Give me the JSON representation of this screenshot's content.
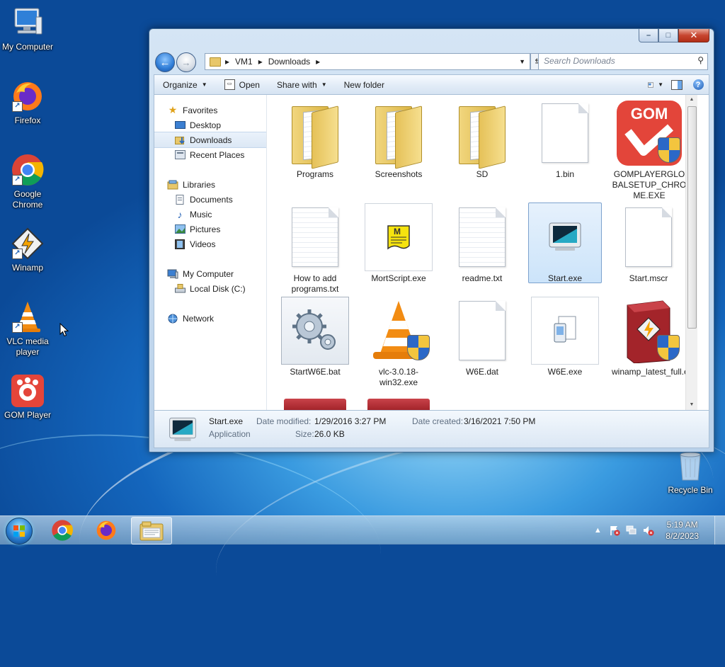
{
  "desktop": {
    "icons": [
      {
        "label": "My Computer"
      },
      {
        "label": "Firefox"
      },
      {
        "label": "Google Chrome"
      },
      {
        "label": "Winamp"
      },
      {
        "label": "VLC media player"
      },
      {
        "label": "GOM Player"
      },
      {
        "label": "Recycle Bin"
      }
    ]
  },
  "window": {
    "breadcrumb": [
      "VM1",
      "Downloads"
    ],
    "search_placeholder": "Search Downloads",
    "toolbar": {
      "organize": "Organize",
      "open": "Open",
      "share_with": "Share with",
      "new_folder": "New folder"
    },
    "nav": {
      "favorites": "Favorites",
      "desktop": "Desktop",
      "downloads": "Downloads",
      "recent_places": "Recent Places",
      "libraries": "Libraries",
      "documents": "Documents",
      "music": "Music",
      "pictures": "Pictures",
      "videos": "Videos",
      "my_computer": "My Computer",
      "local_disk": "Local Disk (C:)",
      "network": "Network"
    },
    "files": [
      {
        "name": "Programs"
      },
      {
        "name": "Screenshots"
      },
      {
        "name": "SD"
      },
      {
        "name": "1.bin"
      },
      {
        "name": "GOMPLAYERGLOBALSETUP_CHROME.EXE"
      },
      {
        "name": "How to add programs.txt"
      },
      {
        "name": "MortScript.exe"
      },
      {
        "name": "readme.txt"
      },
      {
        "name": "Start.exe"
      },
      {
        "name": "Start.mscr"
      },
      {
        "name": "StartW6E.bat"
      },
      {
        "name": "vlc-3.0.18-win32.exe"
      },
      {
        "name": "W6E.dat"
      },
      {
        "name": "W6E.exe"
      },
      {
        "name": "winamp_latest_full.exe"
      }
    ],
    "details": {
      "name": "Start.exe",
      "type": "Application",
      "modified_label": "Date modified:",
      "modified": "1/29/2016 3:27 PM",
      "size_label": "Size:",
      "size": "26.0 KB",
      "created_label": "Date created:",
      "created": "3/16/2021 7:50 PM"
    }
  },
  "taskbar": {
    "time": "5:19 AM",
    "date": "8/2/2023"
  }
}
